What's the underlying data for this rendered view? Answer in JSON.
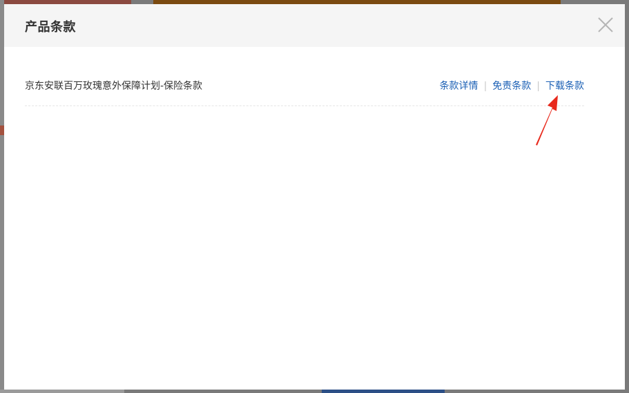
{
  "modal": {
    "title": "产品条款",
    "close_icon": "close-icon"
  },
  "terms": {
    "product_name": "京东安联百万玫瑰意外保障计划-保险条款",
    "links": {
      "details": "条款详情",
      "exemption": "免责条款",
      "download": "下载条款"
    },
    "separator": "|"
  },
  "colors": {
    "link": "#1a5fb4",
    "annotation": "#e8291c",
    "header_bg": "#f5f5f5"
  }
}
